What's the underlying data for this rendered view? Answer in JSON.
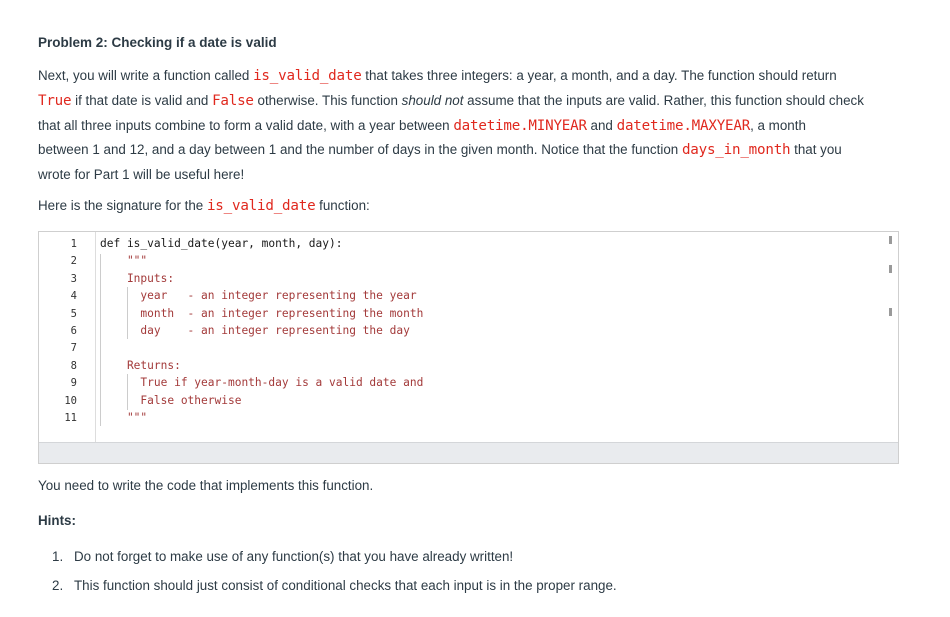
{
  "heading": "Problem 2: Checking if a date is valid",
  "intro": {
    "s1": "Next, you will write a function called ",
    "func_name": "is_valid_date",
    "s2": " that takes three integers: a year, a month, and a day. The function should return",
    "true_kw": "True",
    "s3": " if that date is valid and ",
    "false_kw": "False",
    "s4": " otherwise. This function ",
    "emphasis": "should not",
    "s5": " assume that the inputs are valid. Rather, this function should check",
    "s6": "that all three inputs combine to form a valid date, with a year between ",
    "minyear": "datetime.MINYEAR",
    "s7": " and ",
    "maxyear": "datetime.MAXYEAR",
    "s8": ", a month",
    "s9": "between 1 and 12, and a day between 1 and the number of days in the given month. Notice that the function ",
    "days_func": "days_in_month",
    "s10": " that you",
    "s11": "wrote for Part 1 will be useful here!"
  },
  "signature_intro": {
    "s1": "Here is the signature for the ",
    "func_name": "is_valid_date",
    "s2": " function:"
  },
  "code_lines": [
    {
      "num": "1",
      "text": "def is_valid_date(year, month, day):"
    },
    {
      "num": "2",
      "text": "    \"\"\""
    },
    {
      "num": "3",
      "text": "    Inputs:"
    },
    {
      "num": "4",
      "text": "      year   - an integer representing the year"
    },
    {
      "num": "5",
      "text": "      month  - an integer representing the month"
    },
    {
      "num": "6",
      "text": "      day    - an integer representing the day"
    },
    {
      "num": "7",
      "text": ""
    },
    {
      "num": "8",
      "text": "    Returns:"
    },
    {
      "num": "9",
      "text": "      True if year-month-day is a valid date and"
    },
    {
      "num": "10",
      "text": "      False otherwise"
    },
    {
      "num": "11",
      "text": "    \"\"\""
    }
  ],
  "implement_text": "You need to write the code that implements this function.",
  "hints_title": "Hints:",
  "hints": [
    {
      "num": "1.",
      "text": "Do not forget to make use of any function(s) that you have already written!"
    },
    {
      "num": "2.",
      "text": "This function should just consist of conditional checks that each input is in the proper range."
    }
  ],
  "colors": {
    "code_accent": "#e0281e",
    "body_text": "#2d3b45"
  }
}
